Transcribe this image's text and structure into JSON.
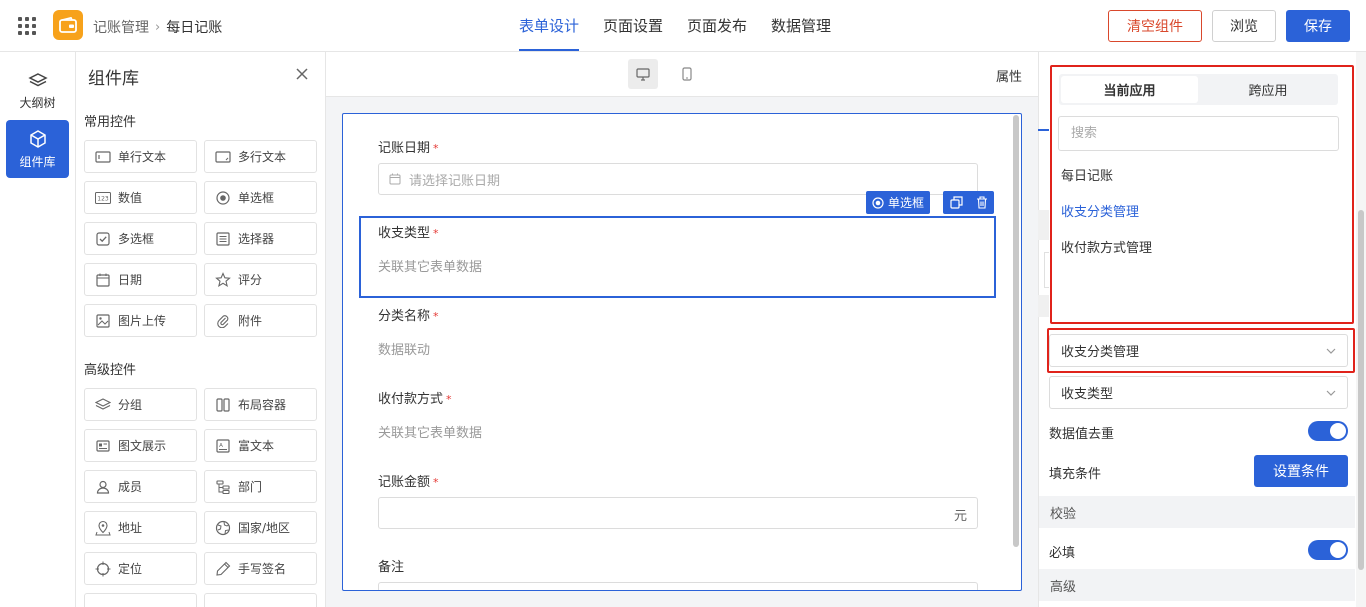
{
  "header": {
    "breadcrumb_parent": "记账管理",
    "breadcrumb_current": "每日记账",
    "tabs": [
      {
        "label": "表单设计",
        "active": true
      },
      {
        "label": "页面设置",
        "active": false
      },
      {
        "label": "页面发布",
        "active": false
      },
      {
        "label": "数据管理",
        "active": false
      }
    ],
    "clear_label": "清空组件",
    "preview_label": "浏览",
    "save_label": "保存"
  },
  "leftnav": {
    "outline_label": "大纲树",
    "library_label": "组件库"
  },
  "library": {
    "title": "组件库",
    "common_title": "常用控件",
    "common": [
      "单行文本",
      "多行文本",
      "数值",
      "单选框",
      "多选框",
      "选择器",
      "日期",
      "评分",
      "图片上传",
      "附件"
    ],
    "advanced_title": "高级控件",
    "advanced": [
      "分组",
      "布局容器",
      "图文展示",
      "富文本",
      "成员",
      "部门",
      "地址",
      "国家/地区",
      "定位",
      "手写签名"
    ]
  },
  "canvas": {
    "attr_label": "属性",
    "selected_chip": "单选框",
    "fields": {
      "date_label": "记账日期",
      "date_placeholder": "请选择记账日期",
      "type_label": "收支类型",
      "type_hint": "关联其它表单数据",
      "cat_label": "分类名称",
      "cat_hint": "数据联动",
      "pay_label": "收付款方式",
      "pay_hint": "关联其它表单数据",
      "amount_label": "记账金额",
      "amount_unit": "元",
      "note_label": "备注"
    },
    "required_mark": "*"
  },
  "right": {
    "tab_current": "当前应用",
    "tab_cross": "跨应用",
    "search_placeholder": "搜索",
    "options": [
      "每日记账",
      "收支分类管理",
      "收付款方式管理"
    ],
    "selected_option": "收支分类管理",
    "form_select": "收支分类管理",
    "field_select": "收支类型",
    "dedup_label": "数据值去重",
    "fill_label": "填充条件",
    "fill_button": "设置条件",
    "verify_section": "校验",
    "required_label": "必填",
    "advanced_section": "高级"
  },
  "colors": {
    "primary": "#2b62d8",
    "danger": "#d9482c",
    "highlight_box": "#e0231b",
    "logo": "#f7a21b"
  }
}
